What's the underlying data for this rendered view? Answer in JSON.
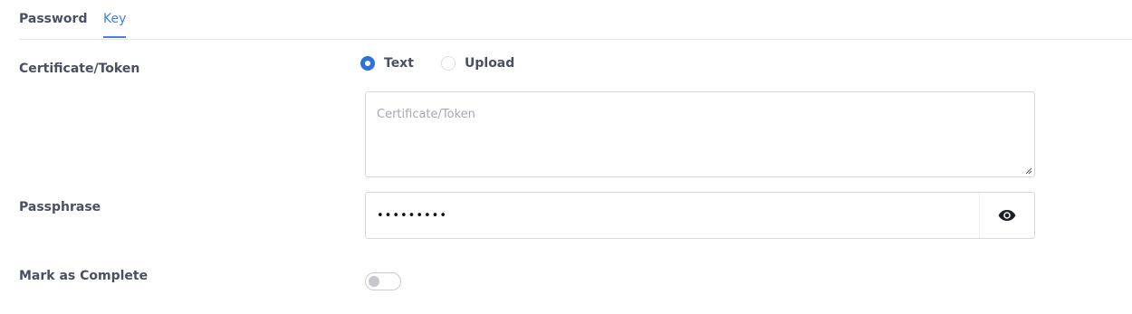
{
  "tabs": {
    "password_label": "Password",
    "key_label": "Key",
    "active": "Key"
  },
  "certificate": {
    "label": "Certificate/Token",
    "mode_options": [
      {
        "label": "Text",
        "selected": true
      },
      {
        "label": "Upload",
        "selected": false
      }
    ],
    "textarea_placeholder": "Certificate/Token",
    "textarea_value": ""
  },
  "passphrase": {
    "label": "Passphrase",
    "masked_value": "•••••••••",
    "toggle_icon": "eye-icon"
  },
  "complete": {
    "label": "Mark as Complete",
    "enabled": false
  },
  "colors": {
    "accent": "#2f6fe4",
    "tab_active": "#4a7de8",
    "label_text": "#4a5062",
    "border": "#d5d8de"
  }
}
